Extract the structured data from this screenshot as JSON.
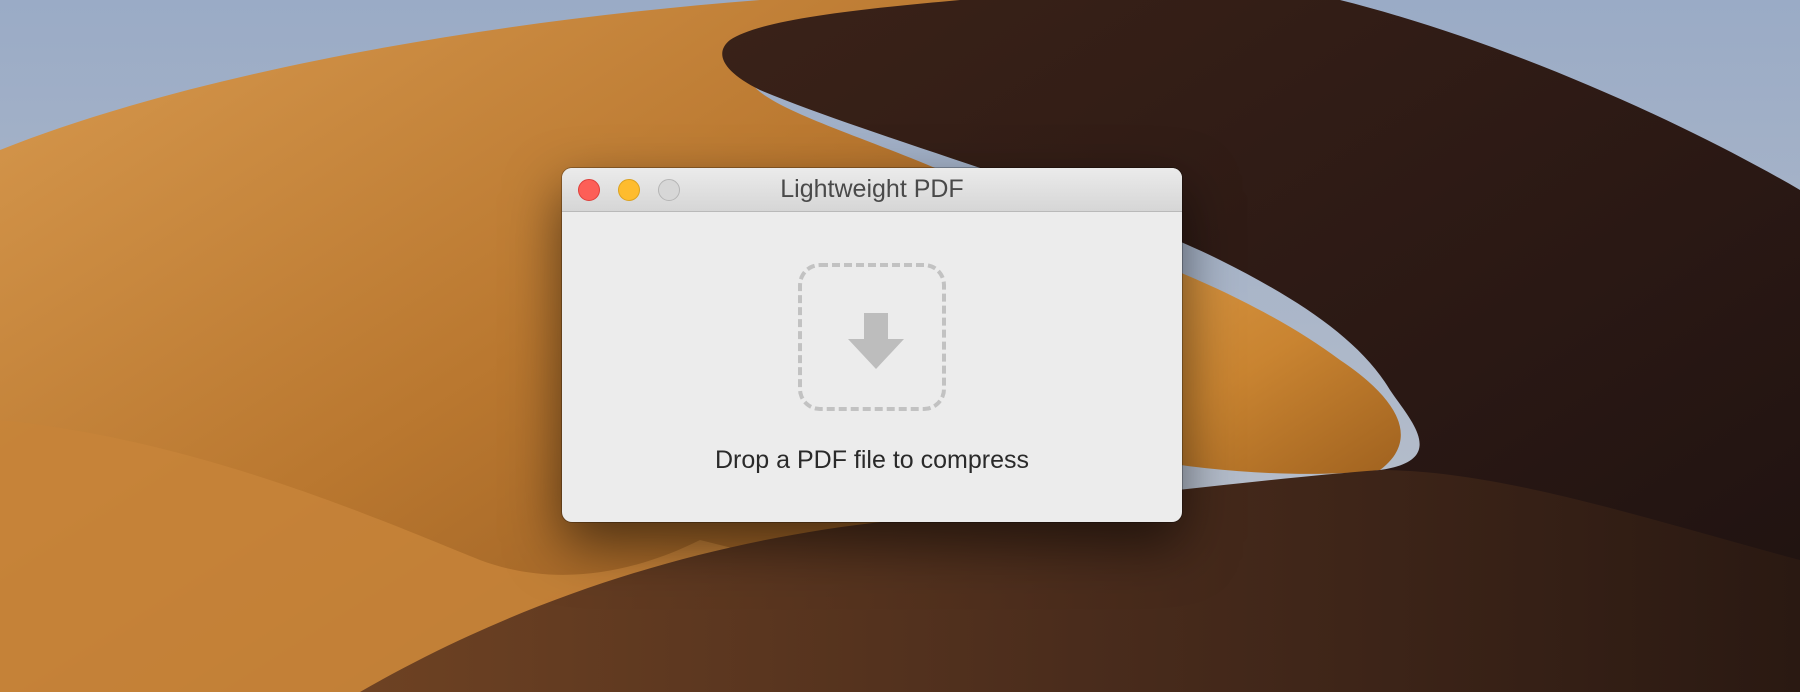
{
  "window": {
    "title": "Lightweight PDF",
    "controls": {
      "close_color": "#fd5f57",
      "minimize_color": "#febc2e",
      "zoom_color": "#d7d7d7"
    }
  },
  "dropzone": {
    "icon": "download-arrow-icon",
    "prompt": "Drop a PDF file to compress"
  }
}
